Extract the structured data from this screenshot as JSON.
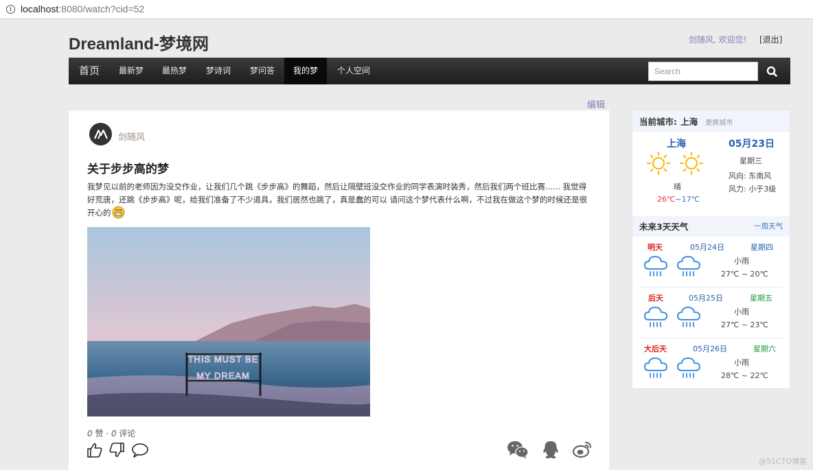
{
  "browser": {
    "url_host": "localhost",
    "url_rest": ":8080/watch?cid=52"
  },
  "header": {
    "brand": "Dreamland-梦境网",
    "welcome": "剑随风, 欢迎您!",
    "logout": "[退出]"
  },
  "nav": {
    "items": [
      "首页",
      "最新梦",
      "最热梦",
      "梦诗词",
      "梦问答",
      "我的梦",
      "个人空间"
    ],
    "active": "我的梦",
    "search_placeholder": "Search"
  },
  "post": {
    "edit": "编辑",
    "author": "剑随风",
    "title": "关于步步高的梦",
    "body": "我梦见以前的老师因为没交作业，让我们几个跳《步步高》的舞蹈，然后让隔壁班没交作业的同学表演时装秀，然后我们两个班比赛...... 我觉得好荒唐，还跳《步步高》呢，给我们准备了不少道具，我们居然也跳了，真是蠢的可以 请问这个梦代表什么啊，不过我在做这个梦的时候还是很开心的",
    "image_text": [
      "THIS MUST BE",
      "MY DREAM"
    ],
    "likes": "0",
    "likes_label": "赞 ·",
    "comments": "0",
    "comments_label": "评论"
  },
  "weather": {
    "current_label": "当前城市:",
    "current_city": "上海",
    "change_city": "更换城市",
    "city": "上海",
    "date": "05月23日",
    "weekday": "星期三",
    "wind_dir": "风向: 东南风",
    "wind_force": "风力: 小于3级",
    "condition": "晴",
    "temp_high": "26℃",
    "temp_sep": "~",
    "temp_low": "17℃",
    "forecast_title": "未来3天天气",
    "week_link": "一周天气",
    "forecast": [
      {
        "rel": "明天",
        "date": "05月24日",
        "weekday": "星期四",
        "cond": "小雨",
        "temp": "27℃ ~ 20℃",
        "weekday_color": "#2a60b0"
      },
      {
        "rel": "后天",
        "date": "05月25日",
        "weekday": "星期五",
        "cond": "小雨",
        "temp": "27℃ ~ 23℃",
        "weekday_color": "#1f9a3a"
      },
      {
        "rel": "大后天",
        "date": "05月26日",
        "weekday": "星期六",
        "cond": "小雨",
        "temp": "28℃ ~ 22℃",
        "weekday_color": "#1f9a3a"
      }
    ]
  },
  "watermark": "@51CTO博客"
}
